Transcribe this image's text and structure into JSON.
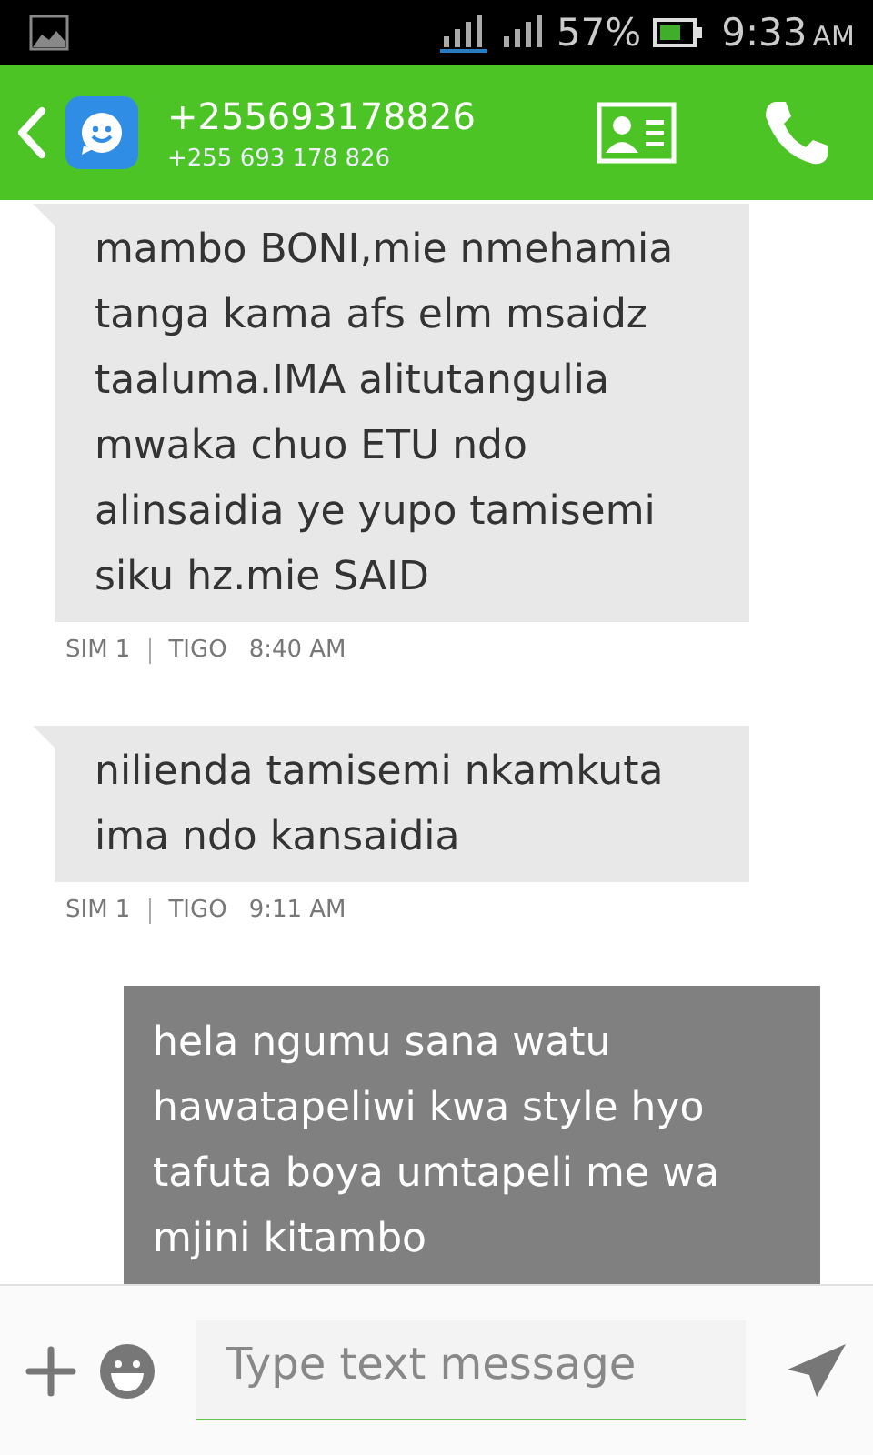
{
  "status_bar": {
    "battery": "57%",
    "time": "9:33",
    "time_suffix": "AM"
  },
  "header": {
    "title": "+255693178826",
    "subtitle": "+255 693 178 826"
  },
  "messages": [
    {
      "kind": "incoming",
      "text": "mambo BONI,mie nmehamia tanga kama afs elm msaidz taaluma.IMA alitutangulia mwaka chuo ETU ndo alinsaidia ye yupo tamisemi siku hz.mie SAID",
      "sim": "SIM 1",
      "carrier": "TIGO",
      "time": "8:40 AM"
    },
    {
      "kind": "incoming",
      "text": "nilienda tamisemi nkamkuta ima ndo kansaidia",
      "sim": "SIM 1",
      "carrier": "TIGO",
      "time": "9:11 AM"
    },
    {
      "kind": "outgoing",
      "text": "hela ngumu sana watu hawatapeliwi kwa style hyo tafuta boya umtapeli me wa mjini kitambo"
    }
  ],
  "composer": {
    "placeholder": "Type text message"
  }
}
